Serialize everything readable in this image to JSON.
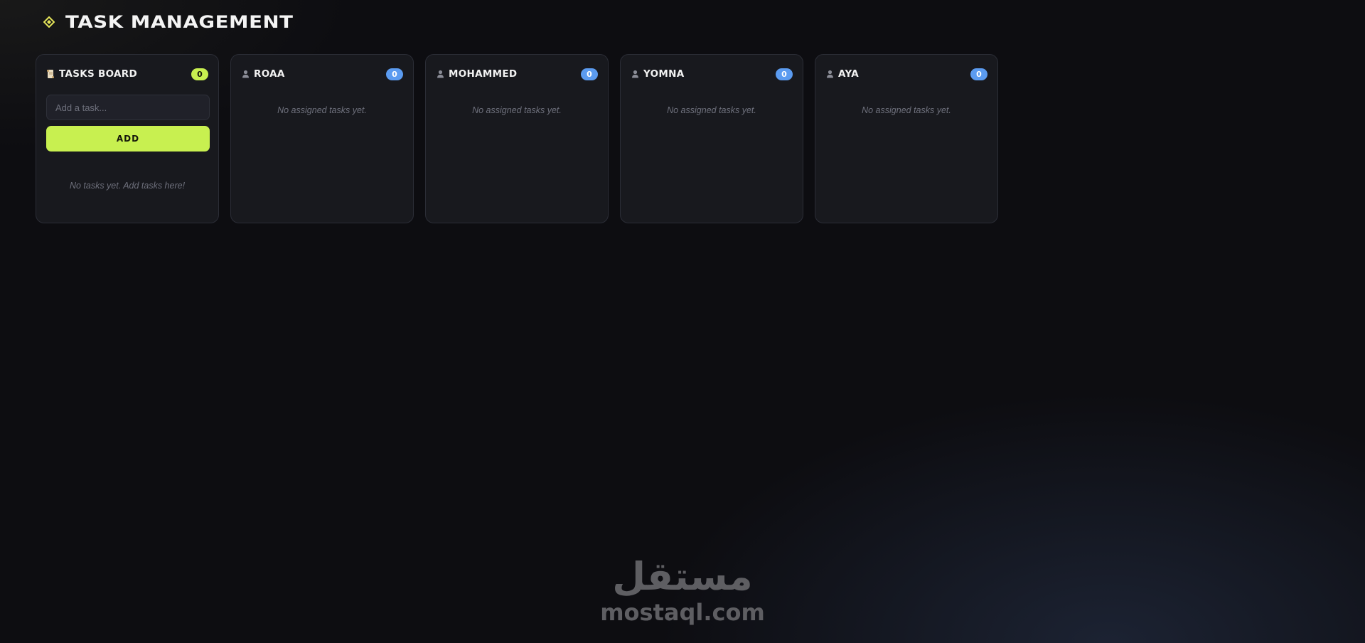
{
  "app": {
    "title": "TASK MANAGEMENT",
    "logo_icon": "diamond-icon",
    "accent_color": "#c8f050",
    "member_badge_color": "#5b9bf0"
  },
  "tasks_board": {
    "title": "TASKS BOARD",
    "icon": "scroll-icon",
    "count": "0",
    "input_placeholder": "Add a task...",
    "input_value": "",
    "add_label": "ADD",
    "empty_text": "No tasks yet. Add tasks here!"
  },
  "members": [
    {
      "name": "ROAA",
      "icon": "person-icon",
      "count": "0",
      "empty_text": "No assigned tasks yet."
    },
    {
      "name": "MOHAMMED",
      "icon": "person-icon",
      "count": "0",
      "empty_text": "No assigned tasks yet."
    },
    {
      "name": "YOMNA",
      "icon": "person-icon",
      "count": "0",
      "empty_text": "No assigned tasks yet."
    },
    {
      "name": "AYA",
      "icon": "person-icon",
      "count": "0",
      "empty_text": "No assigned tasks yet."
    }
  ],
  "watermark": {
    "arabic": "مستقل",
    "latin": "mostaql.com"
  }
}
